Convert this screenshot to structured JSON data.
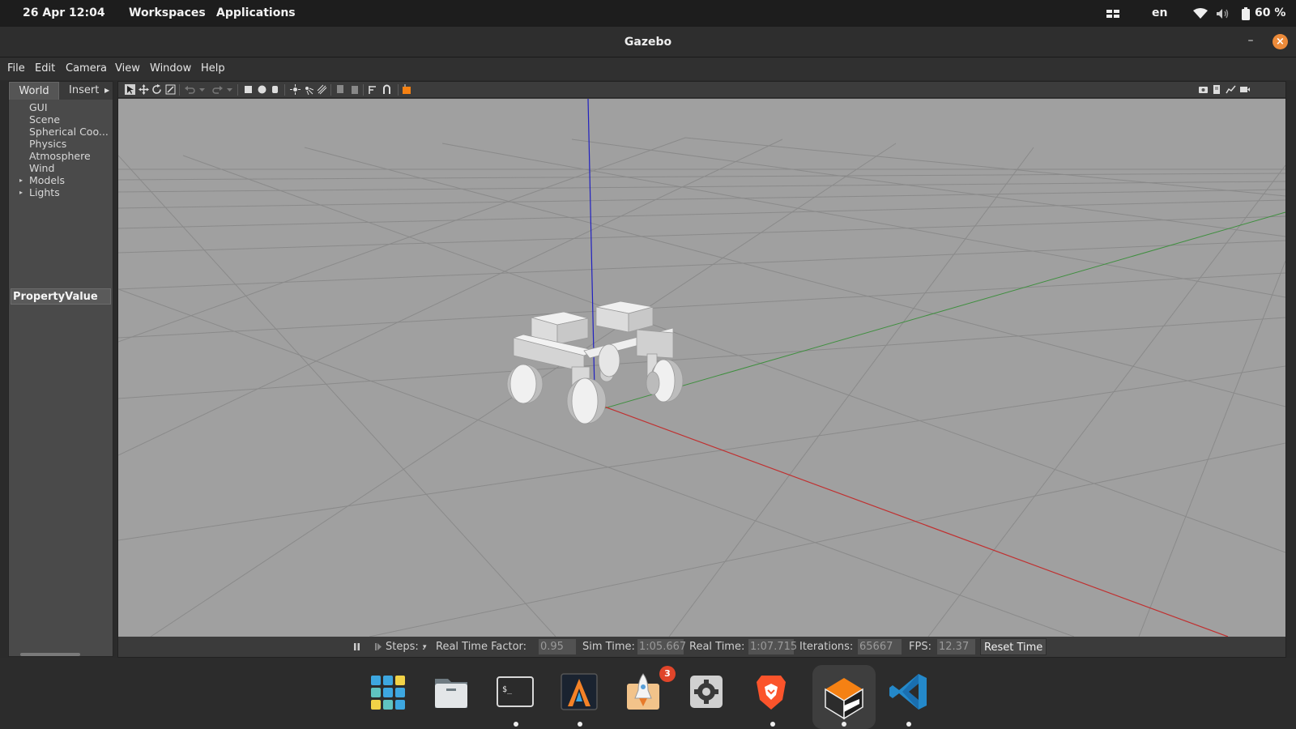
{
  "topbar": {
    "datetime": "26 Apr  12:04",
    "workspaces": "Workspaces",
    "applications": "Applications",
    "language": "en",
    "battery": "60 %",
    "icons": [
      "window-layout-icon",
      "wifi-icon",
      "volume-icon",
      "battery-icon"
    ]
  },
  "window": {
    "title": "Gazebo",
    "minimize": "–",
    "close": "×"
  },
  "menu": [
    "File",
    "Edit",
    "Camera",
    "View",
    "Window",
    "Help"
  ],
  "leftpanel": {
    "tabs": [
      "World",
      "Insert"
    ],
    "tree": [
      {
        "label": "GUI",
        "expandable": false
      },
      {
        "label": "Scene",
        "expandable": false
      },
      {
        "label": "Spherical Coo...",
        "expandable": false
      },
      {
        "label": "Physics",
        "expandable": false
      },
      {
        "label": "Atmosphere",
        "expandable": false
      },
      {
        "label": "Wind",
        "expandable": false
      },
      {
        "label": "Models",
        "expandable": true
      },
      {
        "label": "Lights",
        "expandable": true
      }
    ],
    "property_header": "PropertyValue"
  },
  "toolbar": {
    "icons": [
      "select-arrow-icon",
      "translate-icon",
      "rotate-icon",
      "scale-icon",
      "undo-icon",
      "undo-dropdown-icon",
      "redo-icon",
      "redo-dropdown-icon",
      "box-icon",
      "sphere-icon",
      "cylinder-icon",
      "point-light-icon",
      "spot-light-icon",
      "directional-light-icon",
      "copy-icon",
      "paste-icon",
      "align-icon",
      "snap-icon",
      "change-view-icon",
      "screenshot-icon",
      "log-icon",
      "plot-icon",
      "video-icon"
    ]
  },
  "status": {
    "steps_label": "Steps: .",
    "rtf_label": "Real Time Factor:",
    "rtf_value": "0.95",
    "sim_label": "Sim Time:",
    "sim_value": "1:05.667",
    "real_label": "Real Time:",
    "real_value": "1:07.715",
    "iter_label": "Iterations:",
    "iter_value": "65667",
    "fps_label": "FPS:",
    "fps_value": "12.37",
    "reset_label": "Reset Time"
  },
  "dock": {
    "apps": [
      "app-grid-icon",
      "files-icon",
      "terminal-icon",
      "alacritty-icon",
      "software-updater-icon",
      "settings-icon",
      "brave-icon",
      "gazebo-icon",
      "vscode-icon"
    ],
    "badge": "3",
    "colors": {
      "brave": "#fb542b",
      "vscode": "#2489ca",
      "gazebo": "#f58113"
    }
  }
}
